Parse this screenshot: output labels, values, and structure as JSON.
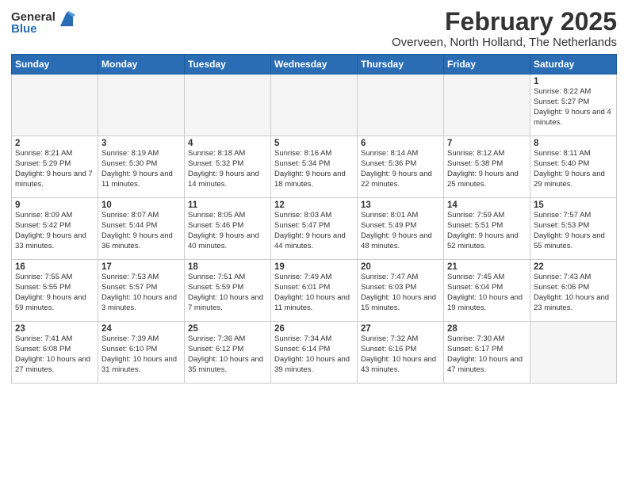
{
  "logo": {
    "general": "General",
    "blue": "Blue"
  },
  "header": {
    "month": "February 2025",
    "location": "Overveen, North Holland, The Netherlands"
  },
  "weekdays": [
    "Sunday",
    "Monday",
    "Tuesday",
    "Wednesday",
    "Thursday",
    "Friday",
    "Saturday"
  ],
  "weeks": [
    [
      {
        "day": "",
        "info": ""
      },
      {
        "day": "",
        "info": ""
      },
      {
        "day": "",
        "info": ""
      },
      {
        "day": "",
        "info": ""
      },
      {
        "day": "",
        "info": ""
      },
      {
        "day": "",
        "info": ""
      },
      {
        "day": "1",
        "info": "Sunrise: 8:22 AM\nSunset: 5:27 PM\nDaylight: 9 hours and 4 minutes."
      }
    ],
    [
      {
        "day": "2",
        "info": "Sunrise: 8:21 AM\nSunset: 5:29 PM\nDaylight: 9 hours and 7 minutes."
      },
      {
        "day": "3",
        "info": "Sunrise: 8:19 AM\nSunset: 5:30 PM\nDaylight: 9 hours and 11 minutes."
      },
      {
        "day": "4",
        "info": "Sunrise: 8:18 AM\nSunset: 5:32 PM\nDaylight: 9 hours and 14 minutes."
      },
      {
        "day": "5",
        "info": "Sunrise: 8:16 AM\nSunset: 5:34 PM\nDaylight: 9 hours and 18 minutes."
      },
      {
        "day": "6",
        "info": "Sunrise: 8:14 AM\nSunset: 5:36 PM\nDaylight: 9 hours and 22 minutes."
      },
      {
        "day": "7",
        "info": "Sunrise: 8:12 AM\nSunset: 5:38 PM\nDaylight: 9 hours and 25 minutes."
      },
      {
        "day": "8",
        "info": "Sunrise: 8:11 AM\nSunset: 5:40 PM\nDaylight: 9 hours and 29 minutes."
      }
    ],
    [
      {
        "day": "9",
        "info": "Sunrise: 8:09 AM\nSunset: 5:42 PM\nDaylight: 9 hours and 33 minutes."
      },
      {
        "day": "10",
        "info": "Sunrise: 8:07 AM\nSunset: 5:44 PM\nDaylight: 9 hours and 36 minutes."
      },
      {
        "day": "11",
        "info": "Sunrise: 8:05 AM\nSunset: 5:46 PM\nDaylight: 9 hours and 40 minutes."
      },
      {
        "day": "12",
        "info": "Sunrise: 8:03 AM\nSunset: 5:47 PM\nDaylight: 9 hours and 44 minutes."
      },
      {
        "day": "13",
        "info": "Sunrise: 8:01 AM\nSunset: 5:49 PM\nDaylight: 9 hours and 48 minutes."
      },
      {
        "day": "14",
        "info": "Sunrise: 7:59 AM\nSunset: 5:51 PM\nDaylight: 9 hours and 52 minutes."
      },
      {
        "day": "15",
        "info": "Sunrise: 7:57 AM\nSunset: 5:53 PM\nDaylight: 9 hours and 55 minutes."
      }
    ],
    [
      {
        "day": "16",
        "info": "Sunrise: 7:55 AM\nSunset: 5:55 PM\nDaylight: 9 hours and 59 minutes."
      },
      {
        "day": "17",
        "info": "Sunrise: 7:53 AM\nSunset: 5:57 PM\nDaylight: 10 hours and 3 minutes."
      },
      {
        "day": "18",
        "info": "Sunrise: 7:51 AM\nSunset: 5:59 PM\nDaylight: 10 hours and 7 minutes."
      },
      {
        "day": "19",
        "info": "Sunrise: 7:49 AM\nSunset: 6:01 PM\nDaylight: 10 hours and 11 minutes."
      },
      {
        "day": "20",
        "info": "Sunrise: 7:47 AM\nSunset: 6:03 PM\nDaylight: 10 hours and 15 minutes."
      },
      {
        "day": "21",
        "info": "Sunrise: 7:45 AM\nSunset: 6:04 PM\nDaylight: 10 hours and 19 minutes."
      },
      {
        "day": "22",
        "info": "Sunrise: 7:43 AM\nSunset: 6:06 PM\nDaylight: 10 hours and 23 minutes."
      }
    ],
    [
      {
        "day": "23",
        "info": "Sunrise: 7:41 AM\nSunset: 6:08 PM\nDaylight: 10 hours and 27 minutes."
      },
      {
        "day": "24",
        "info": "Sunrise: 7:39 AM\nSunset: 6:10 PM\nDaylight: 10 hours and 31 minutes."
      },
      {
        "day": "25",
        "info": "Sunrise: 7:36 AM\nSunset: 6:12 PM\nDaylight: 10 hours and 35 minutes."
      },
      {
        "day": "26",
        "info": "Sunrise: 7:34 AM\nSunset: 6:14 PM\nDaylight: 10 hours and 39 minutes."
      },
      {
        "day": "27",
        "info": "Sunrise: 7:32 AM\nSunset: 6:16 PM\nDaylight: 10 hours and 43 minutes."
      },
      {
        "day": "28",
        "info": "Sunrise: 7:30 AM\nSunset: 6:17 PM\nDaylight: 10 hours and 47 minutes."
      },
      {
        "day": "",
        "info": ""
      }
    ]
  ]
}
